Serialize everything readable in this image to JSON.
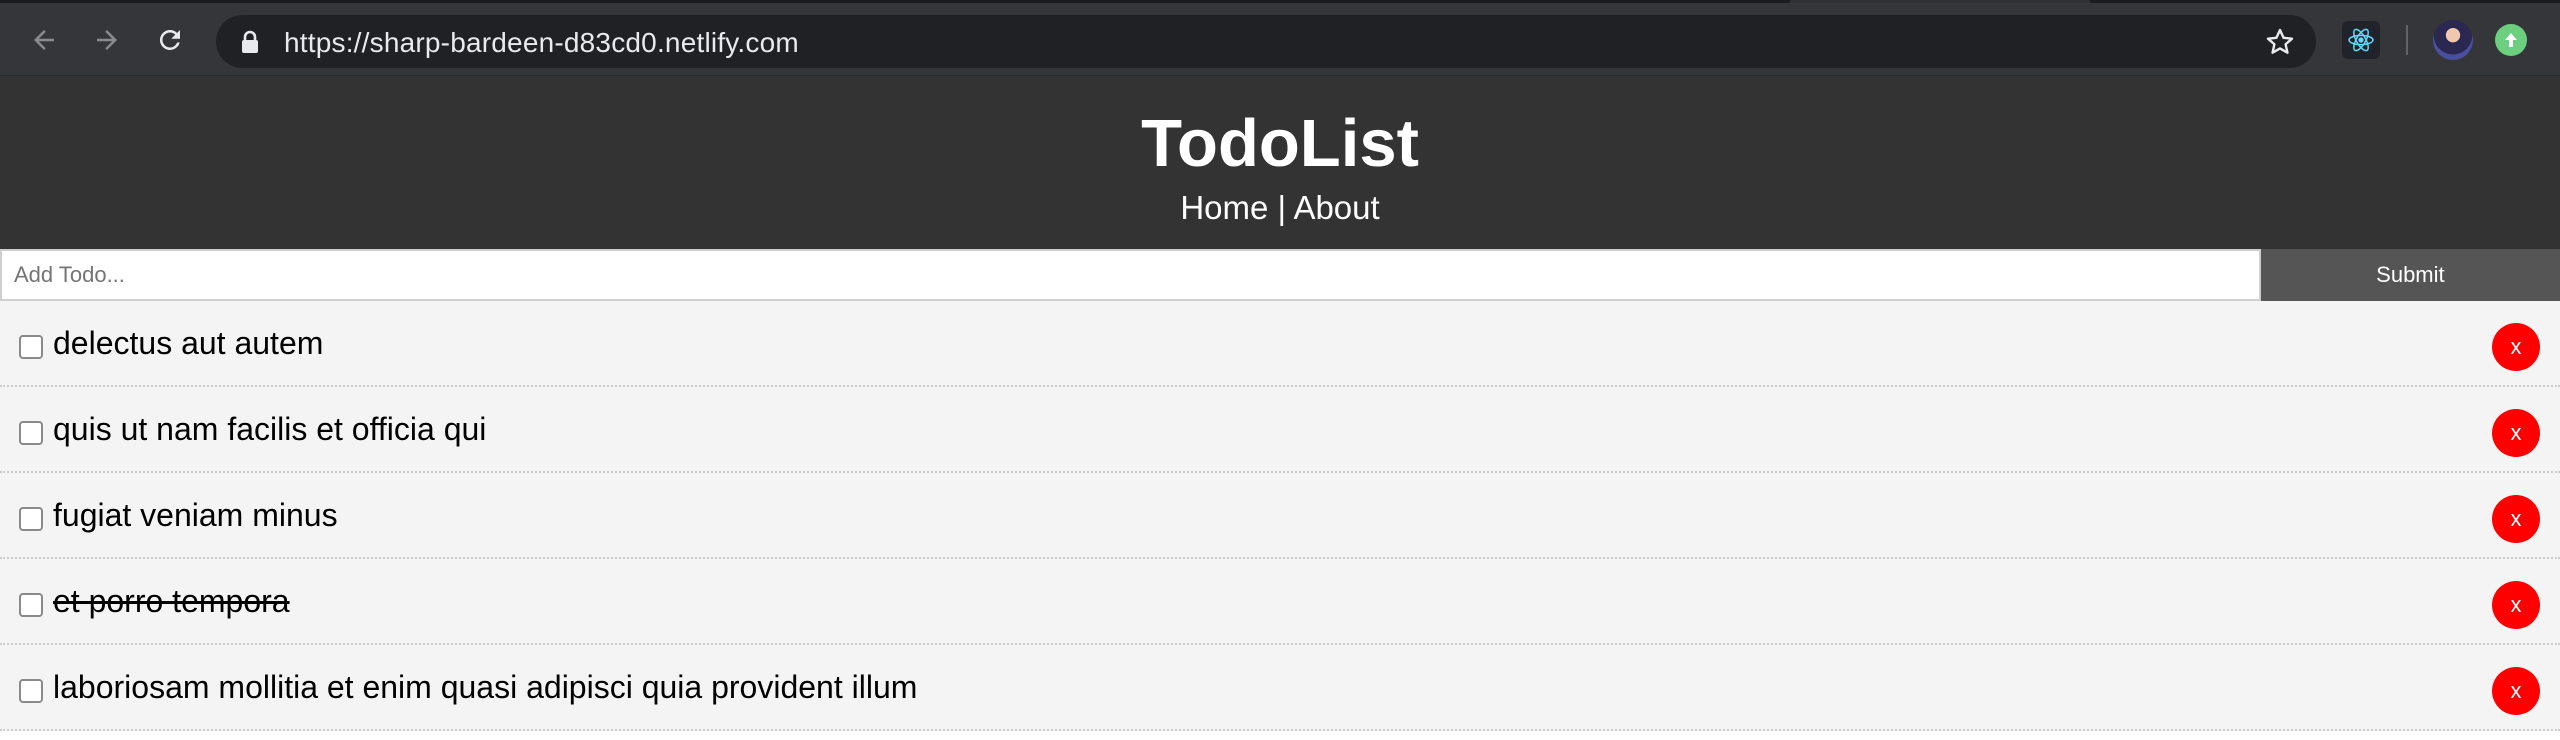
{
  "browser": {
    "url": "https://sharp-bardeen-d83cd0.netlify.com",
    "icons": {
      "back": "arrow-left-icon",
      "forward": "arrow-right-icon",
      "reload": "reload-icon",
      "lock": "lock-icon",
      "bookmark": "star-icon",
      "react_devtools": "react-icon",
      "profile": "avatar",
      "update": "arrow-up-icon"
    }
  },
  "header": {
    "title": "TodoList",
    "nav": {
      "home": "Home",
      "separator": " | ",
      "about": "About"
    }
  },
  "form": {
    "placeholder": "Add Todo...",
    "value": "",
    "submit_label": "Submit"
  },
  "todos": [
    {
      "title": "delectus aut autem",
      "completed": false,
      "delete_label": "x"
    },
    {
      "title": "quis ut nam facilis et officia qui",
      "completed": false,
      "delete_label": "x"
    },
    {
      "title": "fugiat veniam minus",
      "completed": false,
      "delete_label": "x"
    },
    {
      "title": "et porro tempora",
      "completed": true,
      "delete_label": "x"
    },
    {
      "title": "laboriosam mollitia et enim quasi adipisci quia provident illum",
      "completed": false,
      "delete_label": "x"
    }
  ],
  "colors": {
    "header_bg": "#333333",
    "submit_bg": "#555555",
    "delete_bg": "#ff0000",
    "item_bg": "#f4f4f4"
  }
}
